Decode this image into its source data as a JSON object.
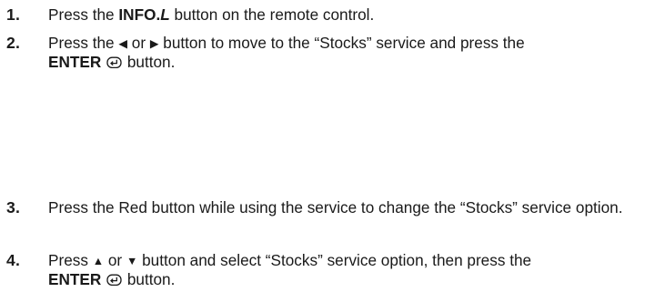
{
  "steps": [
    {
      "number": "1.",
      "t1": "Press the ",
      "b1": "INFO.",
      "b1i": "L",
      "t2": " button on the remote control."
    },
    {
      "number": "2.",
      "t1": "Press the ",
      "g1": "◀",
      "t2": " or ",
      "g2": "▶",
      "t3": " button to move to the “Stocks” service and press the",
      "b1": "ENTER",
      "t4": " button."
    },
    {
      "number": "3.",
      "t1": "Press the Red button while using the service to change the “Stocks” service option."
    },
    {
      "number": "4.",
      "t1": "Press ",
      "g1": "▲",
      "t2": " or ",
      "g2": "▼",
      "t3": " button and select “Stocks” service option, then press the",
      "b1": "ENTER",
      "t4": " button."
    }
  ],
  "icons": {
    "enter": "enter-icon"
  }
}
